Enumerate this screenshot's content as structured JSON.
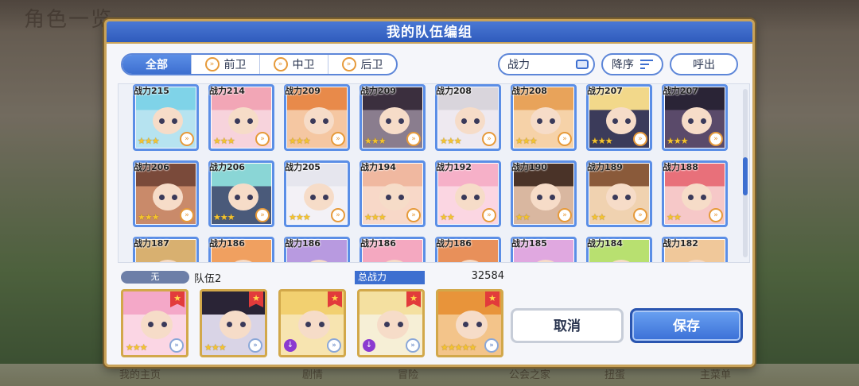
{
  "background": {
    "title": "角色一览",
    "nav": [
      "我的主页",
      "剧情",
      "冒险",
      "公会之家",
      "扭蛋",
      "主菜单"
    ]
  },
  "dialog": {
    "title": "我的队伍编组",
    "filters": [
      {
        "label": "全部",
        "icon": ""
      },
      {
        "label": "前卫",
        "icon": "vanguard-icon"
      },
      {
        "label": "中卫",
        "icon": "midguard-icon"
      },
      {
        "label": "后卫",
        "icon": "rearguard-icon"
      }
    ],
    "sort_key": "战力",
    "sort_order": "降序",
    "call_button": "呼出",
    "roster": [
      {
        "power": "战力215",
        "stars": "★★★",
        "hair": "#7fd3e8",
        "bg": "#b6e3f0"
      },
      {
        "power": "战力214",
        "stars": "★★★",
        "hair": "#f2a6b6",
        "bg": "#f7d3dc"
      },
      {
        "power": "战力209",
        "stars": "★★★",
        "hair": "#e88a4a",
        "bg": "#f5c7a2"
      },
      {
        "power": "战力209",
        "stars": "★★★",
        "hair": "#3b2f3e",
        "bg": "#8a7d8e"
      },
      {
        "power": "战力208",
        "stars": "★★★",
        "hair": "#d9d5dc",
        "bg": "#eee9f0"
      },
      {
        "power": "战力208",
        "stars": "★★★",
        "hair": "#e8a35a",
        "bg": "#f6d2a8"
      },
      {
        "power": "战力207",
        "stars": "★★★",
        "hair": "#f2d88a",
        "bg": "#3b3b5a"
      },
      {
        "power": "战力207",
        "stars": "★★★",
        "hair": "#2a2436",
        "bg": "#5a4a6a"
      },
      {
        "power": "战力206",
        "stars": "★★★",
        "hair": "#7a4a3a",
        "bg": "#c98a6a"
      },
      {
        "power": "战力206",
        "stars": "★★★",
        "hair": "#8ad6d6",
        "bg": "#4a5a7a"
      },
      {
        "power": "战力205",
        "stars": "★★★",
        "hair": "#e6e6ee",
        "bg": "#f3f1f6"
      },
      {
        "power": "战力194",
        "stars": "★★★",
        "hair": "#f0b8a0",
        "bg": "#f8d8c8"
      },
      {
        "power": "战力192",
        "stars": "★★",
        "hair": "#f6b0c8",
        "bg": "#fbd6e2"
      },
      {
        "power": "战力190",
        "stars": "★★",
        "hair": "#4a3328",
        "bg": "#d9b7a0"
      },
      {
        "power": "战力189",
        "stars": "★★",
        "hair": "#8a5a3a",
        "bg": "#f0d2b0"
      },
      {
        "power": "战力188",
        "stars": "★★",
        "hair": "#e8707a",
        "bg": "#f6c8c8"
      },
      {
        "power": "战力187",
        "stars": "★★",
        "hair": "#d8b070",
        "bg": "#f3e2c2"
      },
      {
        "power": "战力186",
        "stars": "★★",
        "hair": "#f0a060",
        "bg": "#f8d2b0"
      },
      {
        "power": "战力186",
        "stars": "★★",
        "hair": "#b89ae0",
        "bg": "#ded0f3"
      },
      {
        "power": "战力186",
        "stars": "★★",
        "hair": "#f4a8c0",
        "bg": "#fbd8e4"
      },
      {
        "power": "战力186",
        "stars": "★★",
        "hair": "#e8905a",
        "bg": "#f6cfb0"
      },
      {
        "power": "战力185",
        "stars": "★★",
        "hair": "#e0a8e0",
        "bg": "#f2d6f2"
      },
      {
        "power": "战力184",
        "stars": "★★",
        "hair": "#b8e070",
        "bg": "#e2f2c8"
      },
      {
        "power": "战力182",
        "stars": "★★",
        "hair": "#f0c89a",
        "bg": "#fae4cc"
      }
    ],
    "team": {
      "tag": "无",
      "name": "队伍2",
      "total_power_label": "总战力",
      "total_power": "32584",
      "members": [
        {
          "stars": "★★★",
          "hair": "#f4a8c8",
          "bg": "#fbd6e4",
          "ue": false
        },
        {
          "stars": "★★★",
          "hair": "#2a2436",
          "bg": "#d9d4e6",
          "ue": false
        },
        {
          "stars": "",
          "hair": "#f2d070",
          "bg": "#f7e4b0",
          "ue": true
        },
        {
          "stars": "",
          "hair": "#f4e0a0",
          "bg": "#f6efd6",
          "ue": true
        },
        {
          "stars": "★★★★★",
          "hair": "#e8943a",
          "bg": "#f3c48a",
          "ue": false
        }
      ]
    },
    "cancel_button": "取消",
    "save_button": "保存"
  }
}
